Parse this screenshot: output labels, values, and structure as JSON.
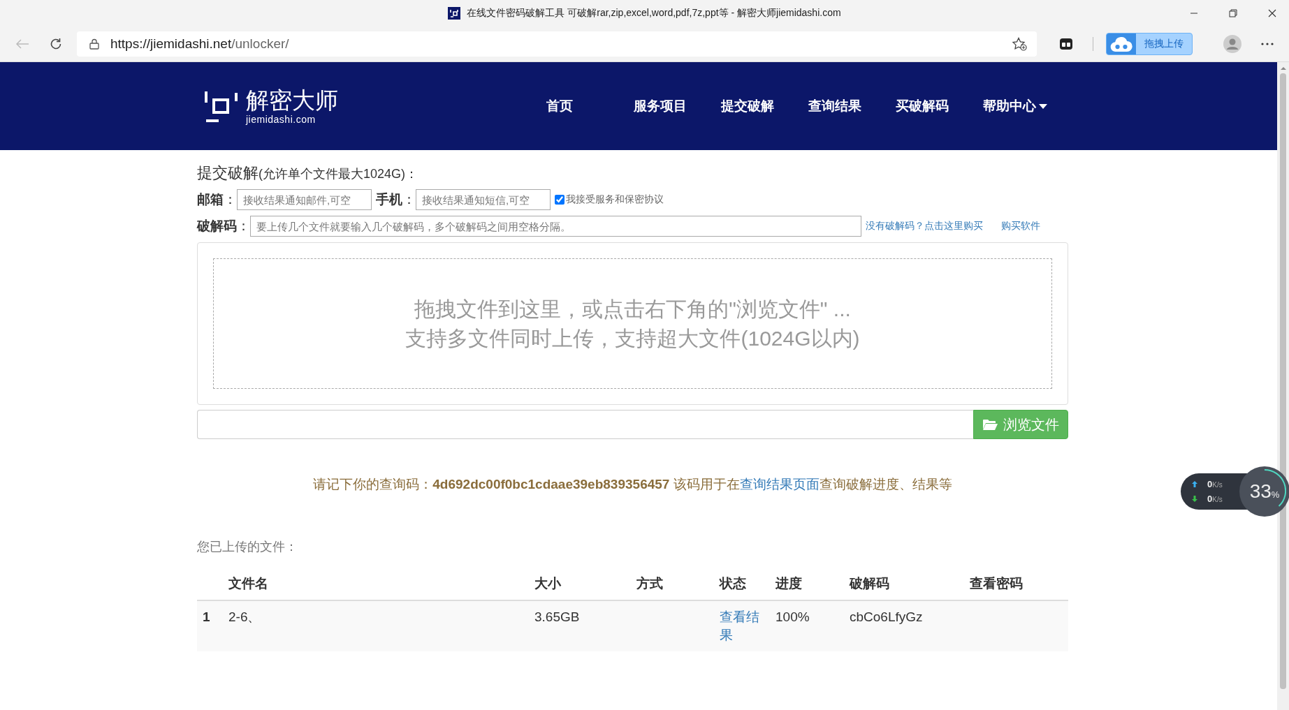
{
  "browser": {
    "window_title": "在线文件密码破解工具 可破解rar,zip,excel,word,pdf,7z,ppt等 - 解密大师jiemidashi.com",
    "address": {
      "host": "https://jiemidashi.net",
      "path": "/unlocker/"
    },
    "extension_button": "拖拽上传"
  },
  "site": {
    "logo": {
      "name": "解密大师",
      "domain": "jiemidashi.com"
    },
    "nav": [
      {
        "label": "首页",
        "dropdown": false
      },
      {
        "label": "服务项目",
        "dropdown": false
      },
      {
        "label": "提交破解",
        "dropdown": false
      },
      {
        "label": "查询结果",
        "dropdown": false
      },
      {
        "label": "买破解码",
        "dropdown": false
      },
      {
        "label": "帮助中心",
        "dropdown": true
      }
    ]
  },
  "form": {
    "title": "提交破解",
    "title_note": "(允许单个文件最大1024G)：",
    "email": {
      "label": "**邮箱**：",
      "placeholder": "接收结果通知邮件,可空"
    },
    "phone": {
      "label": "**手机**：",
      "placeholder": "接收结果通知短信,可空"
    },
    "agreement": {
      "label": "我接受服务和保密协议",
      "checked": true
    },
    "code": {
      "label": "**破解码**：",
      "placeholder": "要上传几个文件就要输入几个破解码，多个破解码之间用空格分隔。"
    },
    "links": [
      "没有破解码？点击这里购买",
      "购买软件"
    ]
  },
  "dropzone": {
    "lines": [
      "拖拽文件到这里，或点击右下角的\"浏览文件\" ...",
      "支持多文件同时上传，支持超大文件(1024G以内)"
    ]
  },
  "browse_button": "浏览文件",
  "query": {
    "before": "请记下你的查询码：**4d692dc00f0bc1cdaae39eb839356457** 该码用于在",
    "link": "查询结果页面",
    "after": "查询破解进度、结果等"
  },
  "uploads": {
    "title": "您已上传的文件：",
    "columns": [
      "文件名",
      "大小",
      "方式",
      "状态",
      "进度",
      "破解码",
      "查看密码"
    ],
    "rows": [
      {
        "index": "1",
        "name": "2-6、",
        "size": "3.65GB",
        "status": "查看结果",
        "progress": "100%",
        "code": "cbCo6LfyGz"
      }
    ]
  },
  "speed_widget": {
    "upload": {
      "value": "0",
      "unit": "K/s"
    },
    "download": {
      "value": "0",
      "unit": "K/s"
    },
    "percent": "33",
    "percent_sign": "%"
  }
}
